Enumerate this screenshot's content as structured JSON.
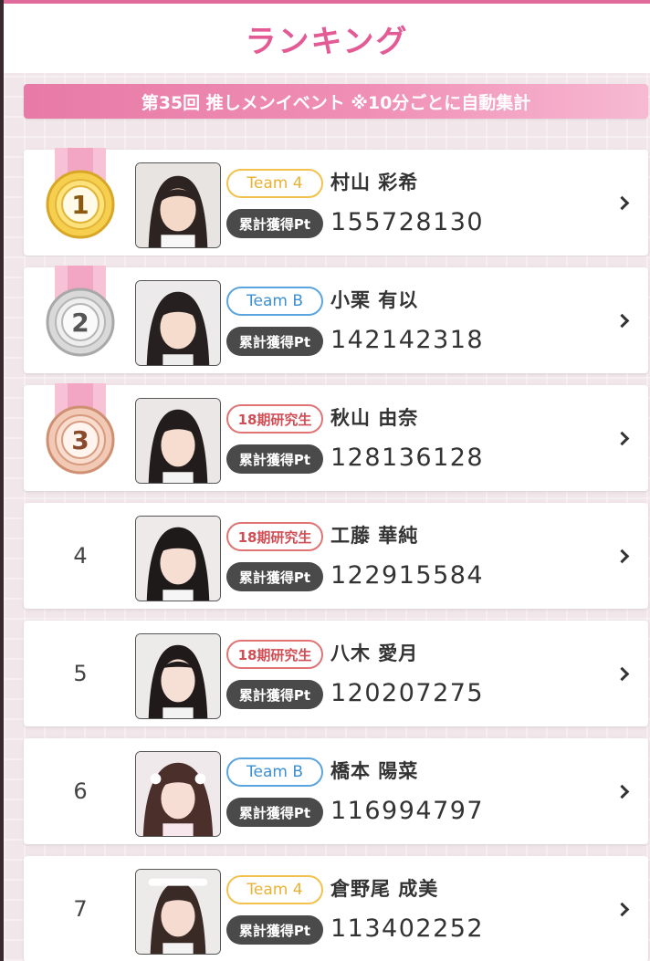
{
  "header": {
    "title": "ランキング"
  },
  "event_banner": {
    "text": "第35回 推しメンイベント ※10分ごとに自動集計"
  },
  "points_label": "累計獲得Pt",
  "rankings": [
    {
      "rank": "1",
      "team": "Team 4",
      "team_color": "#f2c24d",
      "name": "村山 彩希",
      "points": "155728130",
      "medal": "gold"
    },
    {
      "rank": "2",
      "team": "Team B",
      "team_color": "#5aa5df",
      "name": "小栗 有以",
      "points": "142142318",
      "medal": "silver"
    },
    {
      "rank": "3",
      "team": "18期研究生",
      "team_color": "#e07475",
      "name": "秋山 由奈",
      "points": "128136128",
      "medal": "bronze"
    },
    {
      "rank": "4",
      "team": "18期研究生",
      "team_color": "#e07475",
      "name": "工藤 華純",
      "points": "122915584"
    },
    {
      "rank": "5",
      "team": "18期研究生",
      "team_color": "#e07475",
      "name": "八木 愛月",
      "points": "120207275"
    },
    {
      "rank": "6",
      "team": "Team B",
      "team_color": "#5aa5df",
      "name": "橋本 陽菜",
      "points": "116994797"
    },
    {
      "rank": "7",
      "team": "Team 4",
      "team_color": "#f2c24d",
      "name": "倉野尾 成美",
      "points": "113402252"
    }
  ],
  "icons": {
    "row_arrow": "chevron-right-icon",
    "medal": "medal-icon"
  },
  "colors": {
    "accent": "#e35a95",
    "banner": "#ec7eab",
    "gold": "#f2c24d",
    "blue": "#5aa5df",
    "red": "#e07475"
  }
}
